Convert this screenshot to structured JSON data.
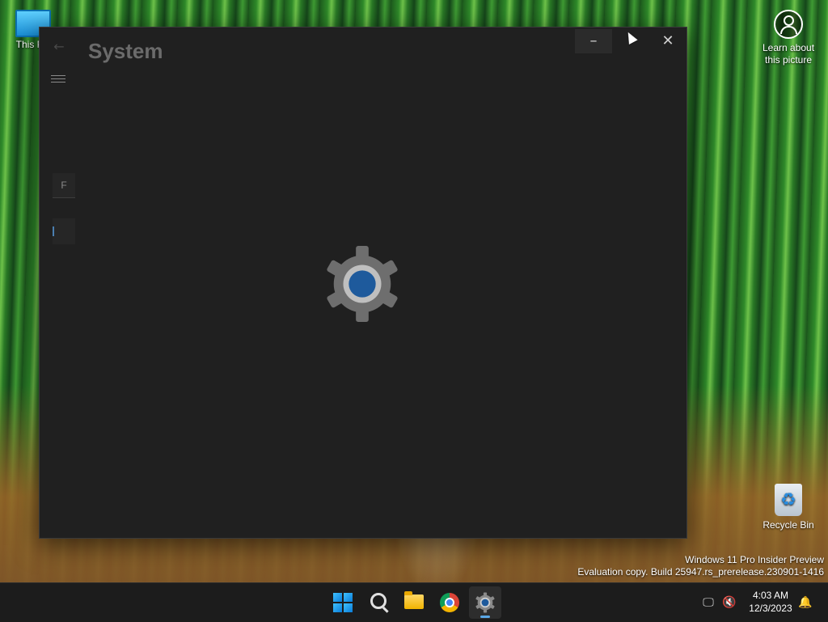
{
  "desktop": {
    "this_pc_label": "This PC",
    "recycle_bin_label": "Recycle Bin",
    "learn_line1": "Learn about",
    "learn_line2": "this picture"
  },
  "window": {
    "title": "System",
    "back_glyph": "←",
    "search_stub_text": "F",
    "minimize_glyph": "–",
    "maximize_glyph": "",
    "close_glyph": "✕",
    "accent": "#1e5a9c"
  },
  "watermark": {
    "line1": "Windows 11 Pro Insider Preview",
    "line2": "Evaluation copy. Build 25947.rs_prerelease.230901-1416"
  },
  "taskbar": {
    "apps": [
      "start-icon",
      "search-icon",
      "file-explorer-icon",
      "chrome-icon",
      "settings-icon"
    ],
    "tray": {
      "time": "4:03 AM",
      "date": "12/3/2023",
      "network_glyph": "🖵",
      "volume_glyph": "🔇",
      "bell_glyph": "🔔"
    }
  }
}
